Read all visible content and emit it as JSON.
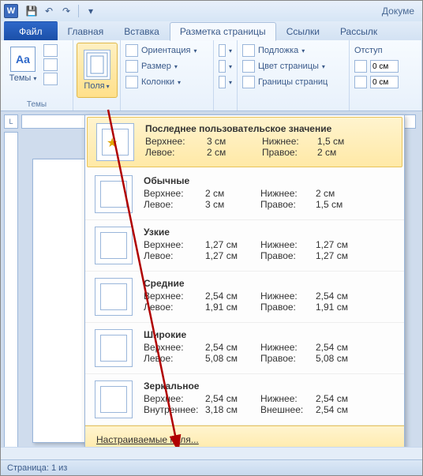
{
  "title_right": "Докуме",
  "qat": {
    "save": "💾",
    "undo": "↶",
    "redo": "↷",
    "more": "▾"
  },
  "tabs": {
    "file": "Файл",
    "home": "Главная",
    "insert": "Вставка",
    "layout": "Разметка страницы",
    "refs": "Ссылки",
    "mail": "Рассылк"
  },
  "ribbon": {
    "themes_group": "Темы",
    "themes_btn": "Темы",
    "themes_icon": "Aa",
    "margins_btn": "Поля",
    "orientation": "Ориентация",
    "size": "Размер",
    "columns": "Колонки",
    "watermark": "Подложка",
    "pagecolor": "Цвет страницы",
    "borders": "Границы страниц",
    "indent": "Отступ",
    "indent_left": "0 см",
    "indent_right": "0 см"
  },
  "ruler_corner": "L",
  "presets": [
    {
      "name": "Последнее пользовательское значение",
      "l1": "Верхнее:",
      "v1": "3 см",
      "l2": "Нижнее:",
      "v2": "1,5 см",
      "l3": "Левое:",
      "v3": "2 см",
      "l4": "Правое:",
      "v4": "2 см"
    },
    {
      "name": "Обычные",
      "l1": "Верхнее:",
      "v1": "2 см",
      "l2": "Нижнее:",
      "v2": "2 см",
      "l3": "Левое:",
      "v3": "3 см",
      "l4": "Правое:",
      "v4": "1,5 см"
    },
    {
      "name": "Узкие",
      "l1": "Верхнее:",
      "v1": "1,27 см",
      "l2": "Нижнее:",
      "v2": "1,27 см",
      "l3": "Левое:",
      "v3": "1,27 см",
      "l4": "Правое:",
      "v4": "1,27 см"
    },
    {
      "name": "Средние",
      "l1": "Верхнее:",
      "v1": "2,54 см",
      "l2": "Нижнее:",
      "v2": "2,54 см",
      "l3": "Левое:",
      "v3": "1,91 см",
      "l4": "Правое:",
      "v4": "1,91 см"
    },
    {
      "name": "Широкие",
      "l1": "Верхнее:",
      "v1": "2,54 см",
      "l2": "Нижнее:",
      "v2": "2,54 см",
      "l3": "Левое:",
      "v3": "5,08 см",
      "l4": "Правое:",
      "v4": "5,08 см"
    },
    {
      "name": "Зеркальное",
      "l1": "Верхнее:",
      "v1": "2,54 см",
      "l2": "Нижнее:",
      "v2": "2,54 см",
      "l3": "Внутреннее:",
      "v3": "3,18 см",
      "l4": "Внешнее:",
      "v4": "2,54 см"
    }
  ],
  "custom_margins": "Настраиваемые поля...",
  "status": "Страница: 1 из"
}
